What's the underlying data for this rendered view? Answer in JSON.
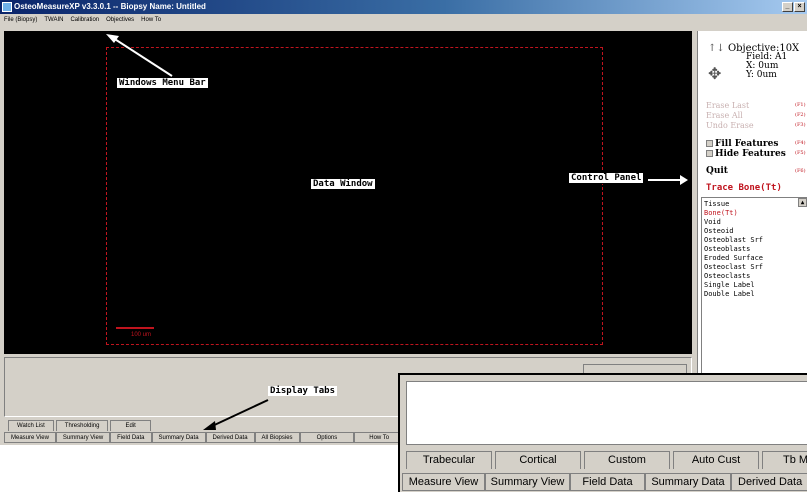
{
  "window": {
    "title": "OsteoMeasureXP v3.3.0.1 -- Biopsy Name: Untitled",
    "min_glyph": "_",
    "close_glyph": "×"
  },
  "menu": [
    "File (Biopsy)",
    "TWAIN",
    "Calibration",
    "Objectives",
    "How To"
  ],
  "data_window": {
    "scale_label": "100 um"
  },
  "control_panel": {
    "objective": "Objective:10X",
    "field": "Field: A1",
    "x": "X: 0um",
    "y": "Y: 0um",
    "commands": [
      {
        "label": "Erase Last",
        "key": "(F1)"
      },
      {
        "label": "Erase All",
        "key": "(F2)"
      },
      {
        "label": "Undo Erase",
        "key": "(F3)"
      }
    ],
    "toggles": [
      {
        "label": "Fill Features",
        "key": "(F4)"
      },
      {
        "label": "Hide Features",
        "key": "(F5)"
      }
    ],
    "quit": {
      "label": "Quit",
      "key": "(F6)"
    },
    "trace_label": "Trace Bone(Tt)",
    "features": [
      "Tissue",
      "Bone(Tt)",
      "Void",
      "Osteoid",
      "Osteoblast Srf",
      "Osteoblasts",
      "Eroded Surface",
      "Osteoclast Srf",
      "Osteoclasts",
      "Single Label",
      "Double Label"
    ],
    "selected_feature": "Bone(Tt)"
  },
  "tabs_row1": [
    "Watch List",
    "Thresholding",
    "Edit"
  ],
  "tabs_row2": [
    "Measure View",
    "Summary View",
    "Field Data",
    "Summary Data",
    "Derived Data",
    "All Biopsies",
    "Options",
    "How To"
  ],
  "annotations": {
    "menu_bar": "Windows Menu Bar",
    "data_window": "Data Window",
    "control_panel": "Control Panel",
    "display_tabs": "Display Tabs"
  },
  "zoom": {
    "tabs_row1": [
      "Trabecular",
      "Cortical",
      "Custom",
      "Auto Cust",
      "Tb Men"
    ],
    "tabs_row2": [
      "Measure View",
      "Summary View",
      "Field Data",
      "Summary Data",
      "Derived Data"
    ]
  },
  "colors": {
    "accent_red": "#c0141e",
    "titlebar": "#0a246a"
  }
}
